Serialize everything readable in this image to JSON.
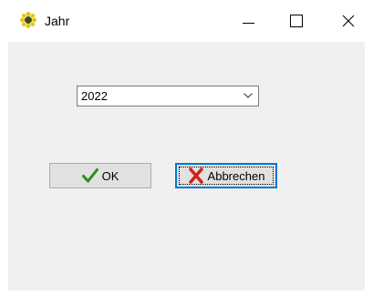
{
  "window": {
    "title": "Jahr",
    "icon": "sunflower-app-icon",
    "controls": {
      "minimize": "minimize-icon",
      "maximize": "maximize-icon",
      "close": "close-icon"
    }
  },
  "year_select": {
    "value": "2022",
    "icon": "chevron-down-icon"
  },
  "buttons": {
    "ok": {
      "label": "OK",
      "icon": "checkmark-icon",
      "icon_color": "#2e8b1e"
    },
    "cancel": {
      "label": "Abbrechen",
      "icon": "red-x-icon",
      "icon_color": "#d0201a",
      "focused": true
    }
  },
  "colors": {
    "client_bg": "#f0f0f0",
    "focus_border": "#0078d7"
  }
}
